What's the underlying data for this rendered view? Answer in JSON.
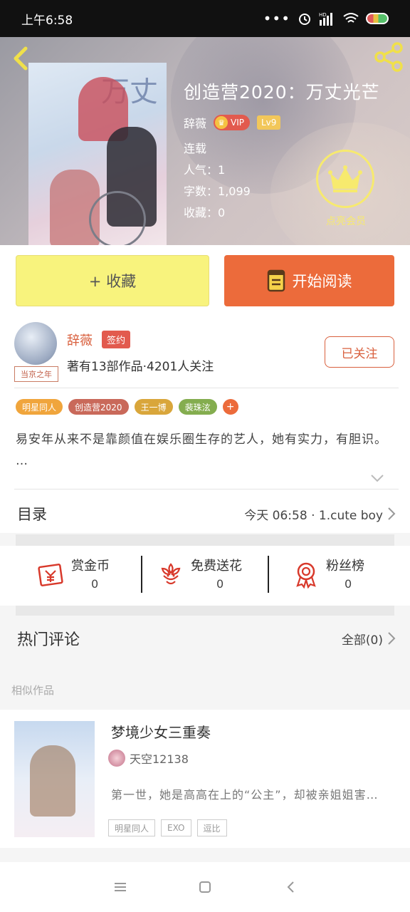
{
  "status_bar": {
    "time": "上午6:58",
    "dots": "•••",
    "hd": "HD"
  },
  "header": {
    "title": "创造营2020：万丈光芒",
    "author": "辞薇",
    "vip_label": "VIP",
    "level": "Lv9",
    "status": "连载",
    "popularity_label": "人气：",
    "popularity": "1",
    "words_label": "字数：",
    "words": "1,099",
    "favorites_label": "收藏：",
    "favorites": "0",
    "member_label": "点亮会员"
  },
  "actions": {
    "favorite": "+ 收藏",
    "read": "开始阅读"
  },
  "author": {
    "name": "辞薇",
    "badge": "签约",
    "avatar_caption": "当京之年",
    "stats": "著有13部作品·4201人关注",
    "follow": "已关注"
  },
  "tags": [
    {
      "label": "明星同人",
      "color": "#f0a53c"
    },
    {
      "label": "创造营2020",
      "color": "#c9695a"
    },
    {
      "label": "王一博",
      "color": "#d9a63b"
    },
    {
      "label": "裴珠泫",
      "color": "#84ad4f"
    }
  ],
  "tag_more": "+",
  "description": "易安年从来不是靠颜值在娱乐圈生存的艺人，她有实力，有胆识。 …",
  "catalog": {
    "label": "目录",
    "latest": "今天 06:58 · 1.cute boy"
  },
  "rewards": [
    {
      "title": "赏金币",
      "count": "0",
      "icon": "red-envelope-icon"
    },
    {
      "title": "免费送花",
      "count": "0",
      "icon": "flower-icon"
    },
    {
      "title": "粉丝榜",
      "count": "0",
      "icon": "medal-icon"
    }
  ],
  "comments": {
    "label": "热门评论",
    "all": "全部(0)"
  },
  "similar": {
    "heading": "相似作品",
    "items": [
      {
        "title": "梦境少女三重奏",
        "author": "天空12138",
        "desc": "第一世，她是高高在上的“公主”，却被亲姐姐害死；第二世…",
        "tags": [
          "明星同人",
          "EXO",
          "逗比"
        ]
      }
    ]
  },
  "colors": {
    "accent": "#ec6b3b",
    "fav_button": "#f8f37d",
    "author_name": "#d9603e",
    "member_gold": "#f7ea6e"
  }
}
